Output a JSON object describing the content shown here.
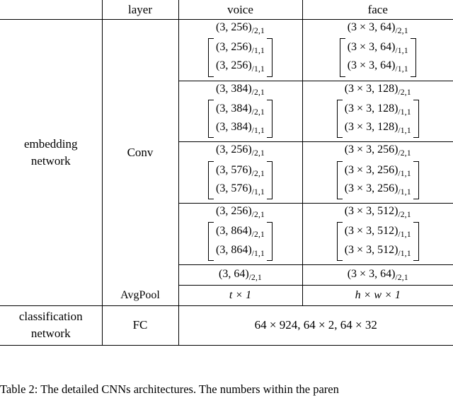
{
  "table": {
    "headers": {
      "group": "",
      "layer": "layer",
      "voice": "voice",
      "face": "face"
    },
    "groups": {
      "embedding": "embedding\nnetwork",
      "embedding_line1": "embedding",
      "embedding_line2": "network",
      "classification_line1": "classification",
      "classification_line2": "network"
    },
    "layers": {
      "conv": "Conv",
      "avgpool": "AvgPool",
      "fc": "FC"
    },
    "conv_blocks": [
      {
        "voice_head": "(3, 256)",
        "voice_head_sub": "/2,1",
        "voice_stack": [
          {
            "text": "(3, 256)",
            "sub": "/1,1"
          },
          {
            "text": "(3, 256)",
            "sub": "/1,1"
          }
        ],
        "face_head": "(3 × 3, 64)",
        "face_head_sub": "/2,1",
        "face_stack": [
          {
            "text": "(3 × 3, 64)",
            "sub": "/1,1"
          },
          {
            "text": "(3 × 3, 64)",
            "sub": "/1,1"
          }
        ]
      },
      {
        "voice_head": "(3, 384)",
        "voice_head_sub": "/2,1",
        "voice_stack": [
          {
            "text": "(3, 384)",
            "sub": "/2,1"
          },
          {
            "text": "(3, 384)",
            "sub": "/1,1"
          }
        ],
        "face_head": "(3 × 3, 128)",
        "face_head_sub": "/2,1",
        "face_stack": [
          {
            "text": "(3 × 3, 128)",
            "sub": "/1,1"
          },
          {
            "text": "(3 × 3, 128)",
            "sub": "/1,1"
          }
        ]
      },
      {
        "voice_head": "(3, 256)",
        "voice_head_sub": "/2,1",
        "voice_stack": [
          {
            "text": "(3, 576)",
            "sub": "/2,1"
          },
          {
            "text": "(3, 576)",
            "sub": "/1,1"
          }
        ],
        "face_head": "(3 × 3, 256)",
        "face_head_sub": "/2,1",
        "face_stack": [
          {
            "text": "(3 × 3, 256)",
            "sub": "/1,1"
          },
          {
            "text": "(3 × 3, 256)",
            "sub": "/1,1"
          }
        ]
      },
      {
        "voice_head": "(3, 256)",
        "voice_head_sub": "/2,1",
        "voice_stack": [
          {
            "text": "(3, 864)",
            "sub": "/2,1"
          },
          {
            "text": "(3, 864)",
            "sub": "/1,1"
          }
        ],
        "face_head": "(3 × 3, 512)",
        "face_head_sub": "/2,1",
        "face_stack": [
          {
            "text": "(3 × 3, 512)",
            "sub": "/1,1"
          },
          {
            "text": "(3 × 3, 512)",
            "sub": "/1,1"
          }
        ]
      }
    ],
    "conv_last": {
      "voice": "(3, 64)",
      "voice_sub": "/2,1",
      "face": "(3 × 3, 64)",
      "face_sub": "/2,1"
    },
    "avgpool": {
      "voice": "t × 1",
      "face": "h × w × 1"
    },
    "fc": {
      "value": "64 × 924, 64 × 2, 64 × 32"
    }
  },
  "caption": {
    "text": "Table 2: The detailed CNNs architectures. The numbers within the paren"
  }
}
